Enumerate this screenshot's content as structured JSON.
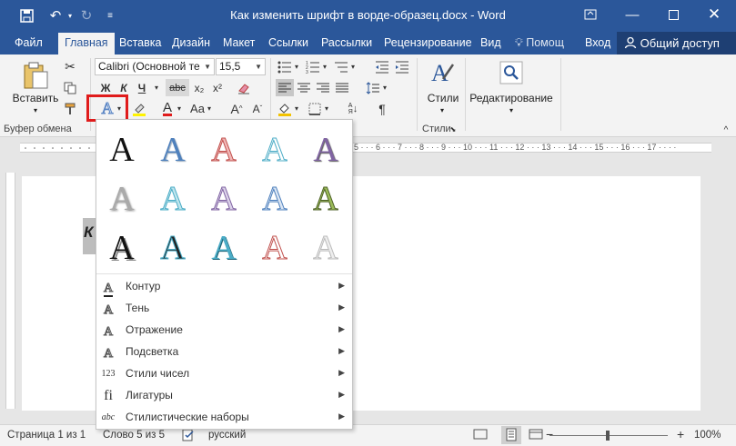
{
  "titlebar": {
    "title": "Как изменить шрифт в ворде-образец.docx - Word",
    "save_icon": "save-icon",
    "undo_icon": "undo-icon",
    "redo_icon": "redo-icon"
  },
  "tabs": [
    "Файл",
    "Главная",
    "Вставка",
    "Дизайн",
    "Макет",
    "Ссылки",
    "Рассылки",
    "Рецензирование",
    "Вид"
  ],
  "tell_me": "Помощ",
  "signin": "Вход",
  "share": "Общий доступ",
  "ribbon": {
    "paste_label": "Вставить",
    "clipboard_group": "Буфер обмена",
    "font_name": "Calibri (Основной те",
    "font_size": "15,5",
    "bold": "Ж",
    "italic": "К",
    "underline": "Ч",
    "strike": "abc",
    "subscript": "x₂",
    "superscript": "x²",
    "styles_label": "Стили",
    "styles_group": "Стили",
    "editing_label": "Редактирование",
    "change_case": "Aa"
  },
  "menu_items": [
    {
      "label": "Контур",
      "icon": "outline-icon"
    },
    {
      "label": "Тень",
      "icon": "shadow-icon"
    },
    {
      "label": "Отражение",
      "icon": "reflection-icon"
    },
    {
      "label": "Подсветка",
      "icon": "glow-icon"
    },
    {
      "label": "Стили чисел",
      "icon": "number-styles-icon"
    },
    {
      "label": "Лигатуры",
      "icon": "ligatures-icon"
    },
    {
      "label": "Стилистические наборы",
      "icon": "stylistic-sets-icon"
    }
  ],
  "statusbar": {
    "page": "Страница 1 из 1",
    "words": "Слово 5 из 5",
    "language": "русский",
    "zoom": "100%"
  },
  "colors": {
    "word_blue": "#2b579a",
    "highlight_red": "#e01b1b"
  }
}
